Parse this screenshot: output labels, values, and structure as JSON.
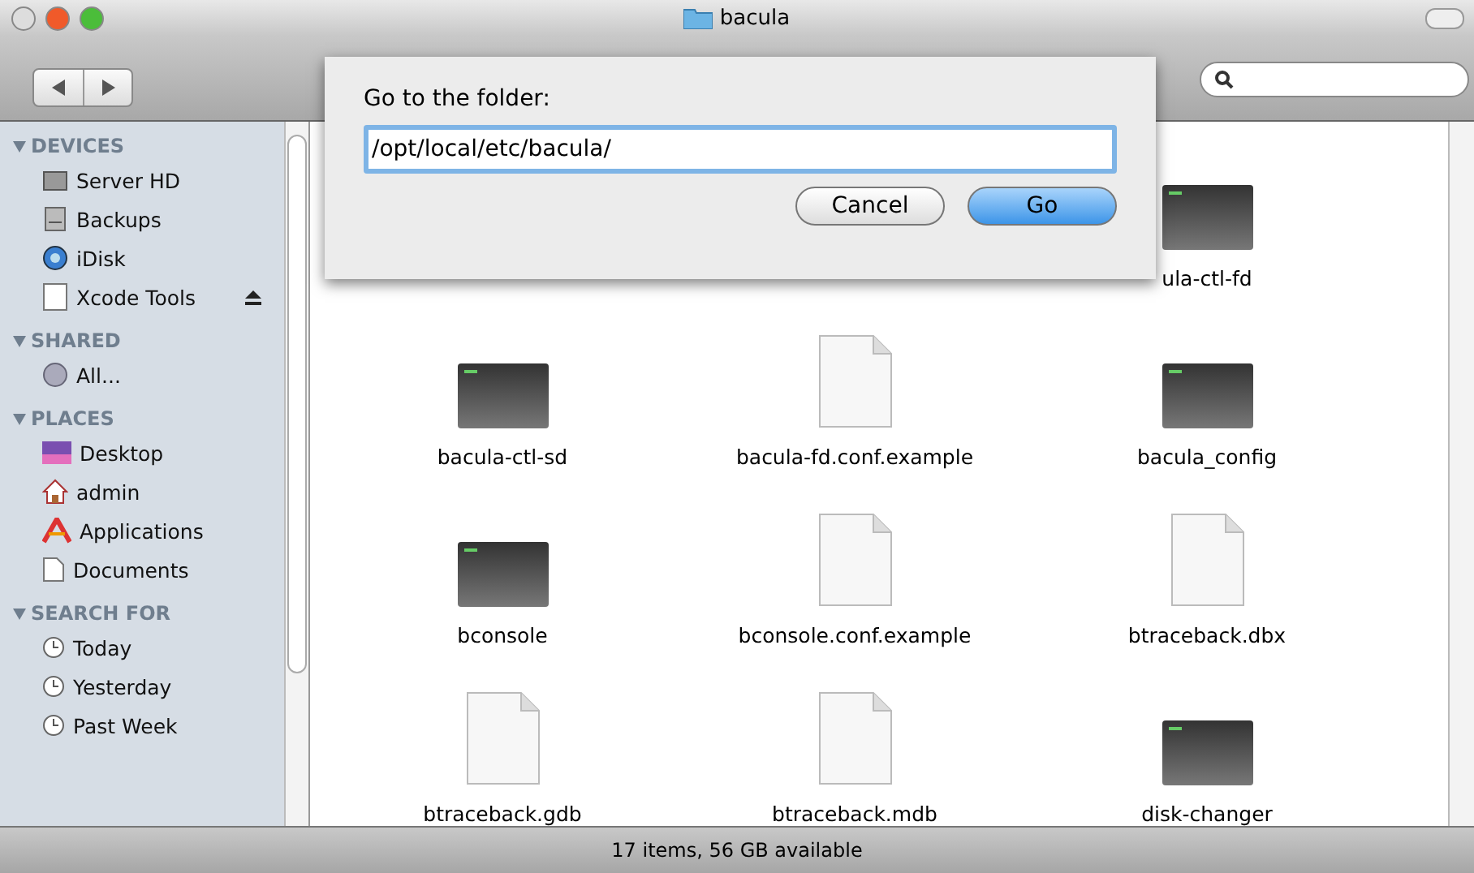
{
  "window": {
    "title": "bacula"
  },
  "sidebar": {
    "sections": [
      {
        "title": "DEVICES",
        "expanded": true,
        "items": [
          {
            "label": "Server HD",
            "kind": "disk",
            "eject": false
          },
          {
            "label": "Backups",
            "kind": "drive",
            "eject": false
          },
          {
            "label": "iDisk",
            "kind": "globe",
            "eject": false
          },
          {
            "label": "Xcode Tools",
            "kind": "volume",
            "eject": true
          }
        ]
      },
      {
        "title": "SHARED",
        "expanded": true,
        "items": [
          {
            "label": "All...",
            "kind": "network",
            "eject": false
          }
        ]
      },
      {
        "title": "PLACES",
        "expanded": true,
        "items": [
          {
            "label": "Desktop",
            "kind": "desktop",
            "eject": false
          },
          {
            "label": "admin",
            "kind": "home",
            "eject": false
          },
          {
            "label": "Applications",
            "kind": "apps",
            "eject": false
          },
          {
            "label": "Documents",
            "kind": "docs",
            "eject": false
          }
        ]
      },
      {
        "title": "SEARCH FOR",
        "expanded": true,
        "items": [
          {
            "label": "Today",
            "kind": "clock",
            "eject": false
          },
          {
            "label": "Yesterday",
            "kind": "clock",
            "eject": false
          },
          {
            "label": "Past Week",
            "kind": "clock",
            "eject": false
          }
        ]
      }
    ]
  },
  "files": [
    {
      "kind": "hidden"
    },
    {
      "kind": "hidden"
    },
    {
      "name": "ula-ctl-fd",
      "kind": "exec"
    },
    {
      "name": "bacula-ctl-sd",
      "kind": "exec"
    },
    {
      "name": "bacula-fd.conf.example",
      "kind": "doc"
    },
    {
      "name": "bacula_config",
      "kind": "exec"
    },
    {
      "name": "bconsole",
      "kind": "exec"
    },
    {
      "name": "bconsole.conf.example",
      "kind": "doc"
    },
    {
      "name": "btraceback.dbx",
      "kind": "doc"
    },
    {
      "name": "btraceback.gdb",
      "kind": "doc"
    },
    {
      "name": "btraceback.mdb",
      "kind": "doc"
    },
    {
      "name": "disk-changer",
      "kind": "exec"
    }
  ],
  "status_bar": "17 items, 56 GB available",
  "dialog": {
    "prompt": "Go to the folder:",
    "value": "/opt/local/etc/bacula/",
    "buttons": [
      {
        "label": "Cancel",
        "default": false
      },
      {
        "label": "Go",
        "default": true
      }
    ]
  }
}
